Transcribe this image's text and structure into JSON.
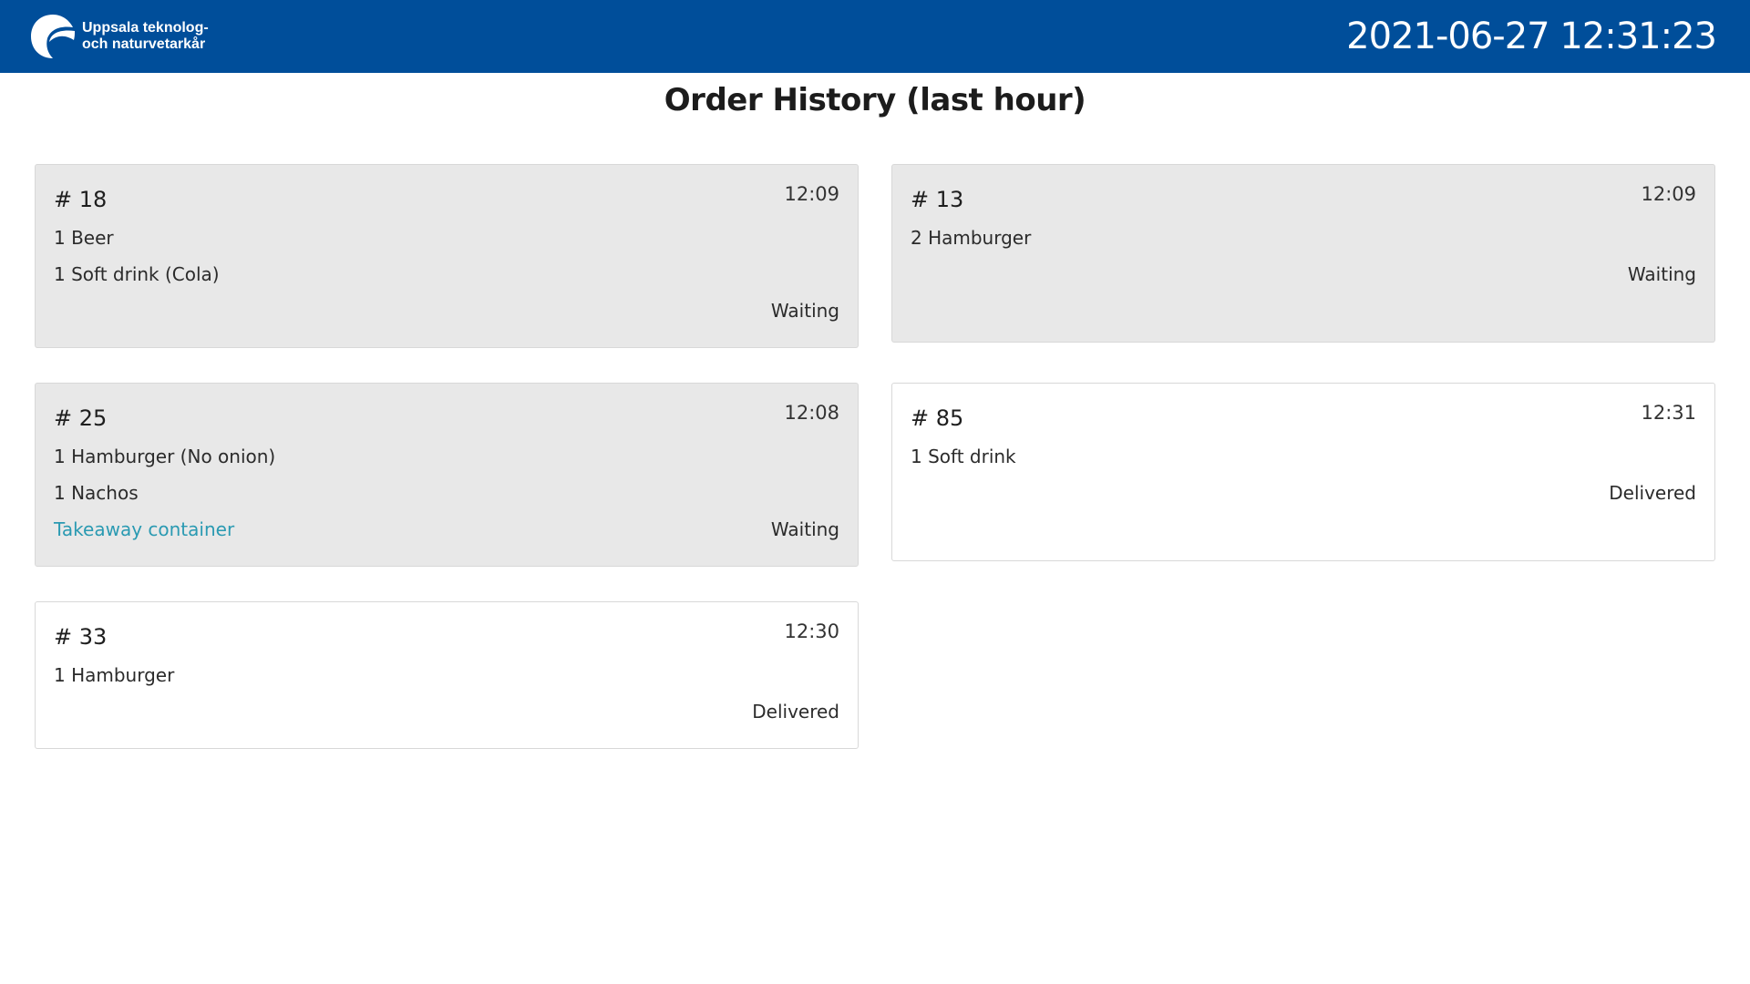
{
  "header": {
    "logo_line1": "Uppsala teknolog-",
    "logo_line2": "och naturvetarkår",
    "clock": "2021-06-27 12:31:23"
  },
  "page": {
    "title": "Order History (last hour)"
  },
  "colors": {
    "brand": "#004e9a",
    "waiting_bg": "#e8e8e8",
    "extra_text": "#2a9ab2"
  },
  "orders": [
    {
      "number": "# 18",
      "time": "12:09",
      "items": [
        "1 Beer",
        "1 Soft drink (Cola)"
      ],
      "extra": "",
      "status": "Waiting"
    },
    {
      "number": "# 13",
      "time": "12:09",
      "items": [
        "2 Hamburger"
      ],
      "extra": "",
      "status": "Waiting"
    },
    {
      "number": "# 25",
      "time": "12:08",
      "items": [
        "1 Hamburger (No onion)",
        "1 Nachos"
      ],
      "extra": "Takeaway container",
      "status": "Waiting"
    },
    {
      "number": "# 85",
      "time": "12:31",
      "items": [
        "1 Soft drink"
      ],
      "extra": "",
      "status": "Delivered"
    },
    {
      "number": "# 33",
      "time": "12:30",
      "items": [
        "1 Hamburger"
      ],
      "extra": "",
      "status": "Delivered"
    }
  ]
}
